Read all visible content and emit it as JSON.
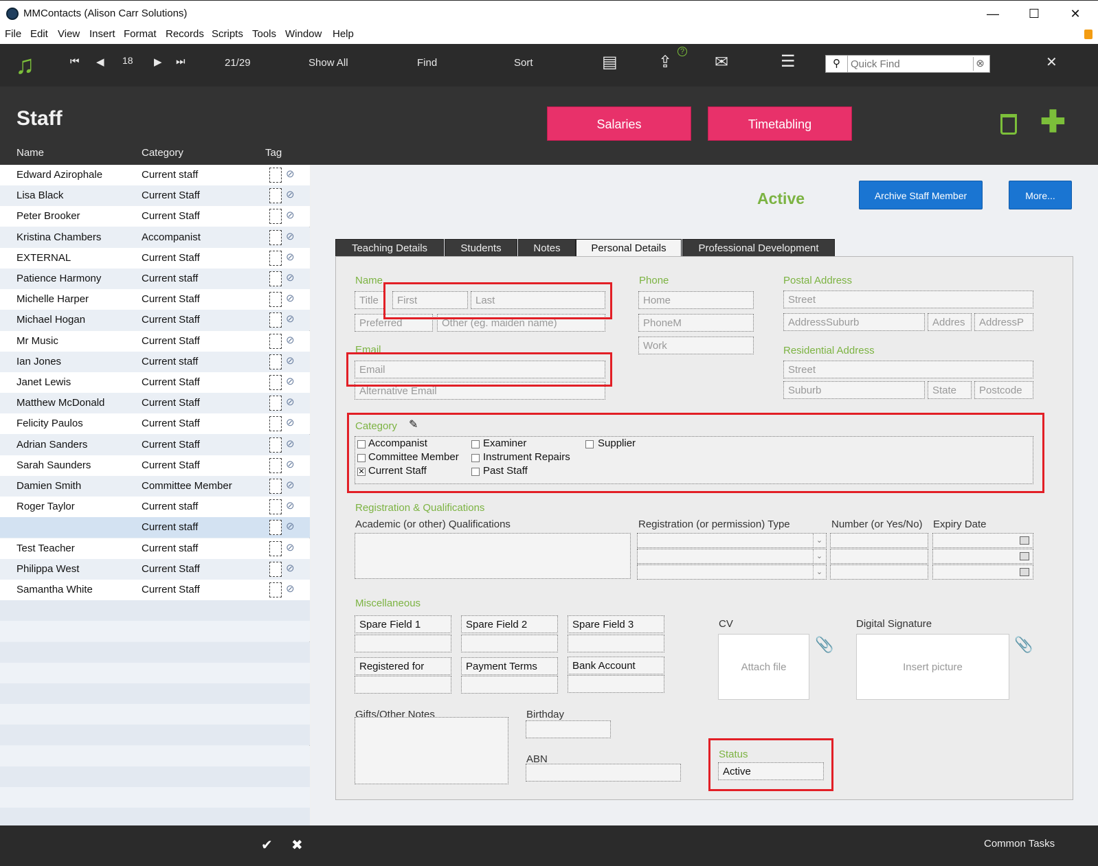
{
  "window": {
    "title": "MMContacts (Alison Carr Solutions)",
    "minimize": "—",
    "maximize": "☐",
    "close": "✕"
  },
  "menu": [
    "File",
    "Edit",
    "View",
    "Insert",
    "Format",
    "Records",
    "Scripts",
    "Tools",
    "Window",
    "Help"
  ],
  "toolbar": {
    "record_number": "18",
    "record_count": "21/29",
    "show_all": "Show All",
    "find": "Find",
    "sort": "Sort",
    "quick_find_placeholder": "Quick Find",
    "help_badge": "?"
  },
  "header": {
    "page_title": "Staff",
    "salaries_button": "Salaries",
    "timetabling_button": "Timetabling",
    "col_name": "Name",
    "col_category": "Category",
    "col_tag": "Tag"
  },
  "staff_list": [
    {
      "name": "Edward Azirophale",
      "category": "Current staff"
    },
    {
      "name": "Lisa Black",
      "category": "Current Staff"
    },
    {
      "name": "Peter Brooker",
      "category": "Current Staff"
    },
    {
      "name": "Kristina Chambers",
      "category": "Accompanist"
    },
    {
      "name": " EXTERNAL",
      "category": "Current Staff"
    },
    {
      "name": "Patience Harmony",
      "category": "Current staff"
    },
    {
      "name": "Michelle Harper",
      "category": "Current Staff"
    },
    {
      "name": "Michael Hogan",
      "category": "Current Staff"
    },
    {
      "name": "Mr Music",
      "category": "Current Staff"
    },
    {
      "name": "Ian Jones",
      "category": "Current staff"
    },
    {
      "name": "Janet Lewis",
      "category": "Current Staff"
    },
    {
      "name": "Matthew McDonald",
      "category": "Current Staff"
    },
    {
      "name": "Felicity Paulos",
      "category": "Current Staff"
    },
    {
      "name": "Adrian Sanders",
      "category": "Current Staff"
    },
    {
      "name": "Sarah Saunders",
      "category": "Current Staff"
    },
    {
      "name": "Damien Smith",
      "category": "Committee Member"
    },
    {
      "name": "Roger Taylor",
      "category": "Current staff"
    },
    {
      "name": "",
      "category": "Current staff",
      "selected": true
    },
    {
      "name": "Test Teacher",
      "category": "Current staff"
    },
    {
      "name": "Philippa West",
      "category": "Current Staff"
    },
    {
      "name": "Samantha White",
      "category": "Current Staff"
    }
  ],
  "record": {
    "status_heading": "Active",
    "archive_button": "Archive Staff Member",
    "more_button": "More..."
  },
  "tabs": [
    {
      "label": "Teaching Details",
      "active": false
    },
    {
      "label": "Students",
      "active": false
    },
    {
      "label": "Notes",
      "active": false
    },
    {
      "label": "Personal Details",
      "active": true
    },
    {
      "label": "Professional Development",
      "active": false
    }
  ],
  "personal": {
    "name_label": "Name",
    "title_ph": "Title",
    "first_ph": "First",
    "last_ph": "Last",
    "preferred_ph": "Preferred",
    "other_ph": "Other (eg. maiden name)",
    "email_label": "Email",
    "email_ph": "Email",
    "alt_email_ph": "Alternative Email",
    "phone_label": "Phone",
    "home_ph": "Home",
    "mobile_ph": "PhoneM",
    "work_ph": "Work",
    "postal_label": "Postal Address",
    "postal_street_ph": "Street",
    "postal_suburb_ph": "AddressSuburb",
    "postal_state_ph": "Addres",
    "postal_postcode_ph": "AddressP",
    "res_label": "Residential Address",
    "res_street_ph": "Street",
    "res_suburb_ph": "Suburb",
    "res_state_ph": "State",
    "res_postcode_ph": "Postcode"
  },
  "category": {
    "label": "Category",
    "options": [
      {
        "label": "Accompanist",
        "checked": false
      },
      {
        "label": "Committee Member",
        "checked": false
      },
      {
        "label": "Current Staff",
        "checked": true
      },
      {
        "label": "Examiner",
        "checked": false
      },
      {
        "label": "Instrument Repairs",
        "checked": false
      },
      {
        "label": "Past Staff",
        "checked": false
      },
      {
        "label": "Supplier",
        "checked": false
      }
    ]
  },
  "registration": {
    "section_label": "Registration & Qualifications",
    "academic_label": "Academic (or other) Qualifications",
    "reg_type_label": "Registration (or permission) Type",
    "number_label": "Number (or Yes/No)",
    "expiry_label": "Expiry Date"
  },
  "misc": {
    "section_label": "Miscellaneous",
    "spare1": "Spare Field 1",
    "spare2": "Spare Field 2",
    "spare3": "Spare Field 3",
    "registered_for": "Registered for",
    "payment_terms": "Payment Terms",
    "bank_account": "Bank Account",
    "cv_label": "CV",
    "cv_drop": "Attach file",
    "sig_label": "Digital Signature",
    "sig_drop": "Insert picture",
    "gifts_label": "Gifts/Other Notes",
    "birthday_label": "Birthday",
    "abn_label": "ABN",
    "status_label": "Status",
    "status_value": "Active"
  },
  "footer": {
    "common_tasks": "Common Tasks"
  },
  "colors": {
    "accent_green": "#7cb342",
    "pink": "#e8316a",
    "blue": "#1a75d2",
    "highlight_red": "#e21f26"
  }
}
